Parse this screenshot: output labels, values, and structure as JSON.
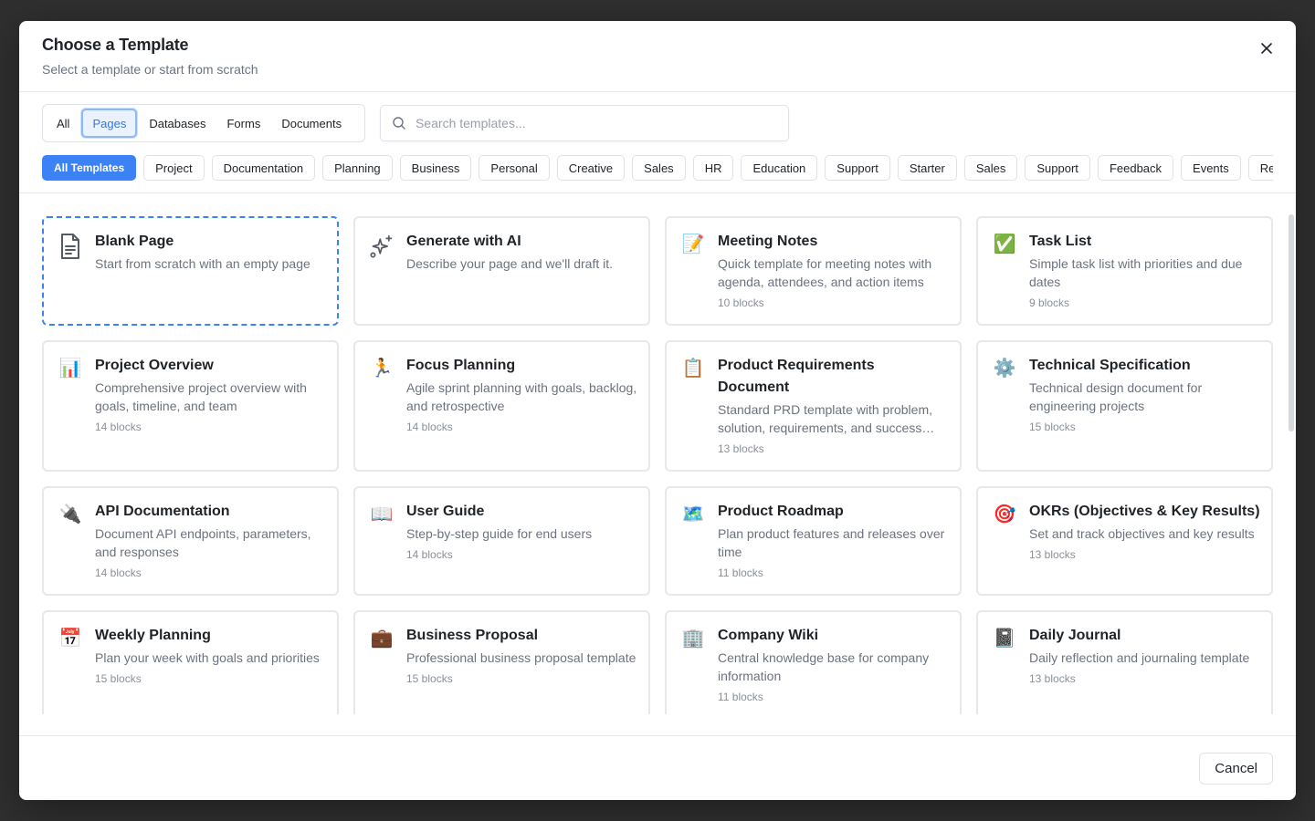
{
  "modal": {
    "title": "Choose a Template",
    "subtitle": "Select a template or start from scratch"
  },
  "type_tabs": [
    {
      "label": "All",
      "active": false
    },
    {
      "label": "Pages",
      "active": true
    },
    {
      "label": "Databases",
      "active": false
    },
    {
      "label": "Forms",
      "active": false
    },
    {
      "label": "Documents",
      "active": false
    }
  ],
  "search": {
    "placeholder": "Search templates..."
  },
  "categories": [
    {
      "label": "All Templates",
      "active": true
    },
    {
      "label": "Project"
    },
    {
      "label": "Documentation"
    },
    {
      "label": "Planning"
    },
    {
      "label": "Business"
    },
    {
      "label": "Personal"
    },
    {
      "label": "Creative"
    },
    {
      "label": "Sales"
    },
    {
      "label": "HR"
    },
    {
      "label": "Education"
    },
    {
      "label": "Support"
    },
    {
      "label": "Starter"
    },
    {
      "label": "Sales"
    },
    {
      "label": "Support"
    },
    {
      "label": "Feedback"
    },
    {
      "label": "Events"
    },
    {
      "label": "Recru"
    }
  ],
  "templates": [
    {
      "title": "Blank Page",
      "desc": "Start from scratch with an empty page",
      "blocks": "",
      "icon": "page-icon",
      "glyph": ""
    },
    {
      "title": "Generate with AI",
      "desc": "Describe your page and we'll draft it.",
      "blocks": "",
      "icon": "sparkles-icon",
      "glyph": ""
    },
    {
      "title": "Meeting Notes",
      "desc": "Quick template for meeting notes with agenda, attendees, and action items",
      "blocks": "10 blocks",
      "icon": "memo-icon",
      "glyph": "📝"
    },
    {
      "title": "Task List",
      "desc": "Simple task list with priorities and due dates",
      "blocks": "9 blocks",
      "icon": "check-mark-icon",
      "glyph": "✅"
    },
    {
      "title": "Project Overview",
      "desc": "Comprehensive project overview with goals, timeline, and team",
      "blocks": "14 blocks",
      "icon": "bar-chart-icon",
      "glyph": "📊"
    },
    {
      "title": "Focus Planning",
      "desc": "Agile sprint planning with goals, backlog, and retrospective",
      "blocks": "14 blocks",
      "icon": "runner-icon",
      "glyph": "🏃"
    },
    {
      "title": "Product Requirements Document",
      "desc": "Standard PRD template with problem, solution, requirements, and success…",
      "blocks": "13 blocks",
      "icon": "clipboard-icon",
      "glyph": "📋"
    },
    {
      "title": "Technical Specification",
      "desc": "Technical design document for engineering projects",
      "blocks": "15 blocks",
      "icon": "gear-icon",
      "glyph": "⚙️"
    },
    {
      "title": "API Documentation",
      "desc": "Document API endpoints, parameters, and responses",
      "blocks": "14 blocks",
      "icon": "plug-icon",
      "glyph": "🔌"
    },
    {
      "title": "User Guide",
      "desc": "Step-by-step guide for end users",
      "blocks": "14 blocks",
      "icon": "open-book-icon",
      "glyph": "📖"
    },
    {
      "title": "Product Roadmap",
      "desc": "Plan product features and releases over time",
      "blocks": "11 blocks",
      "icon": "map-icon",
      "glyph": "🗺️"
    },
    {
      "title": "OKRs (Objectives & Key Results)",
      "desc": "Set and track objectives and key results",
      "blocks": "13 blocks",
      "icon": "target-icon",
      "glyph": "🎯"
    },
    {
      "title": "Weekly Planning",
      "desc": "Plan your week with goals and priorities",
      "blocks": "15 blocks",
      "icon": "calendar-icon",
      "glyph": "📅"
    },
    {
      "title": "Business Proposal",
      "desc": "Professional business proposal template",
      "blocks": "15 blocks",
      "icon": "briefcase-icon",
      "glyph": "💼"
    },
    {
      "title": "Company Wiki",
      "desc": "Central knowledge base for company information",
      "blocks": "11 blocks",
      "icon": "office-building-icon",
      "glyph": "🏢"
    },
    {
      "title": "Daily Journal",
      "desc": "Daily reflection and journaling template",
      "blocks": "13 blocks",
      "icon": "notebook-icon",
      "glyph": "📓"
    }
  ],
  "footer": {
    "cancel_label": "Cancel"
  },
  "colors": {
    "accent": "#3b82f6",
    "muted_text": "#6b7280",
    "border": "#e6e8eb"
  }
}
